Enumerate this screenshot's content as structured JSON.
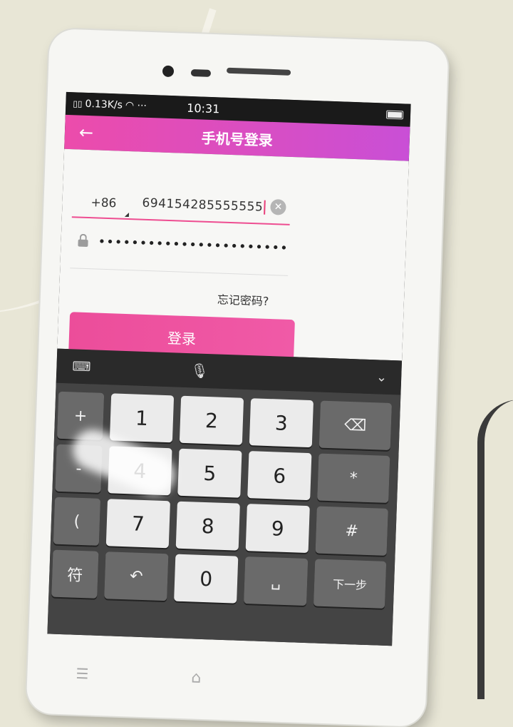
{
  "status_bar": {
    "network_speed": "0.13K/s",
    "time": "10:31"
  },
  "app_bar": {
    "title": "手机号登录",
    "back_label": "←"
  },
  "login_form": {
    "country_code": "+86",
    "phone_value": "694154285555555",
    "password_mask": "•••••••••••••••••••••••",
    "forgot_password": "忘记密码?",
    "login_button": "登录"
  },
  "keyboard": {
    "left_column": [
      "+",
      "-",
      "(",
      "符"
    ],
    "row1": [
      "1",
      "2",
      "3"
    ],
    "row2": [
      "4",
      "5",
      "6"
    ],
    "row3": [
      "7",
      "8",
      "9"
    ],
    "row4_left": "↶",
    "zero": "0",
    "space": "␣",
    "right_column": [
      "⌫",
      "*",
      "#",
      "下一步"
    ]
  },
  "colors": {
    "accent_pink": "#ec4d9a",
    "appbar_gradient_end": "#c94fd6"
  }
}
